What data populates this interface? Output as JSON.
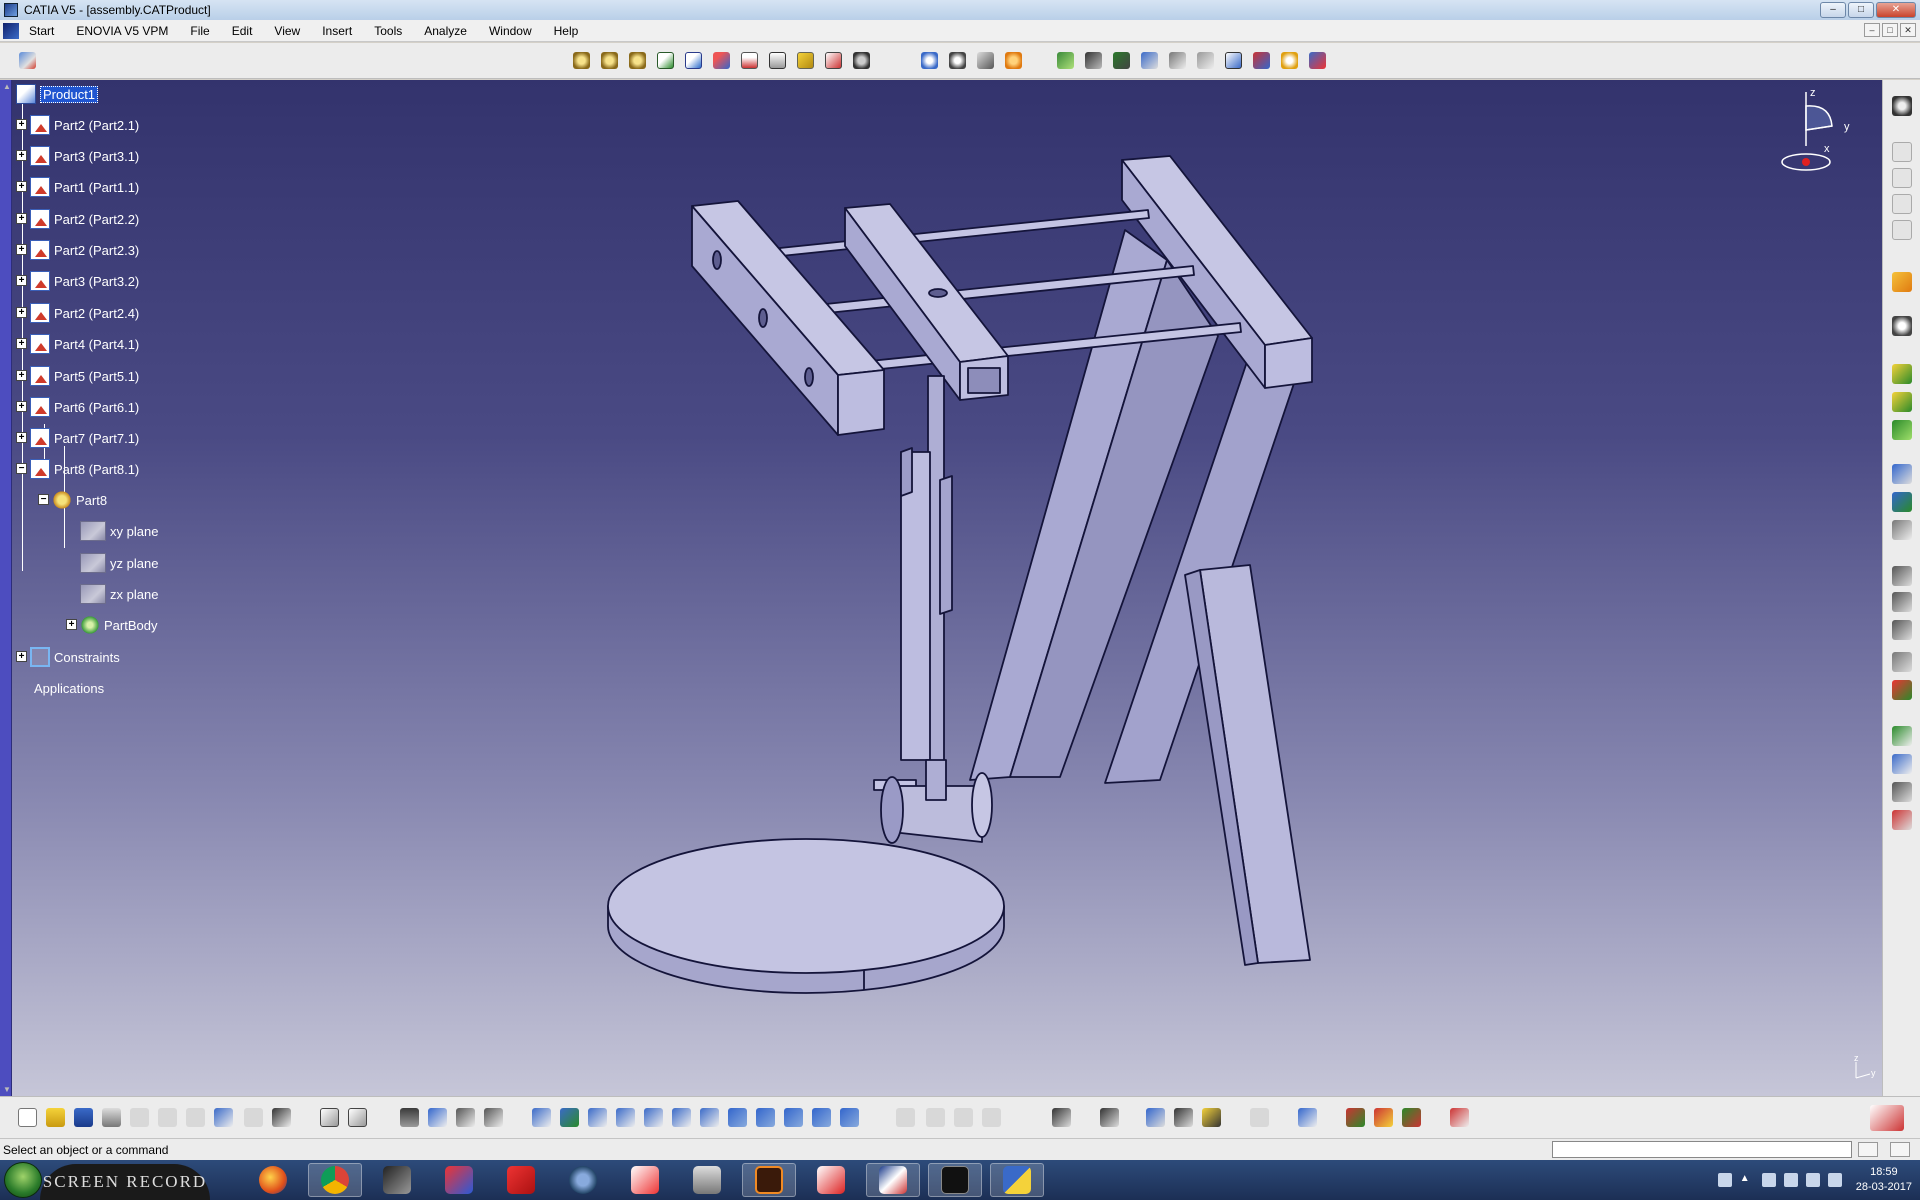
{
  "window": {
    "title": "CATIA V5 - [assembly.CATProduct]",
    "controls": {
      "minimize": "–",
      "maximize": "□",
      "close": "✕"
    }
  },
  "menu": {
    "items": [
      "Start",
      "ENOVIA V5 VPM",
      "File",
      "Edit",
      "View",
      "Insert",
      "Tools",
      "Analyze",
      "Window",
      "Help"
    ]
  },
  "tree": {
    "root": "Product1",
    "parts": [
      "Part2 (Part2.1)",
      "Part3 (Part3.1)",
      "Part1 (Part1.1)",
      "Part2 (Part2.2)",
      "Part2 (Part2.3)",
      "Part3 (Part3.2)",
      "Part2 (Part2.4)",
      "Part4 (Part4.1)",
      "Part5 (Part5.1)",
      "Part6 (Part6.1)",
      "Part7 (Part7.1)",
      "Part8 (Part8.1)"
    ],
    "part8_child": "Part8",
    "planes": [
      "xy plane",
      "yz plane",
      "zx plane"
    ],
    "body": "PartBody",
    "constraints": "Constraints",
    "applications": "Applications"
  },
  "compass": {
    "z": "z",
    "y": "y",
    "x": "x"
  },
  "mini_axis": {
    "z": "z",
    "y": "y"
  },
  "status": {
    "message": "Select an object or a command",
    "command_input": ""
  },
  "taskbar": {
    "recorder_label": "SCREEN RECORD",
    "time": "18:59",
    "date": "28-03-2017",
    "apps": [
      "firefox-icon",
      "chrome-icon",
      "zbrush-icon",
      "app-red-icon",
      "sketchup-icon",
      "app-blue-icon",
      "acrobat-icon",
      "printer-icon",
      "illustrator-icon",
      "app-red2-icon",
      "catia-icon",
      "terminal-icon",
      "python-icon"
    ]
  },
  "colors": {
    "viewport_top": "#33336d",
    "viewport_bottom": "#c6c6d8",
    "model_fill": "#b9b9dc",
    "model_edge": "#14143a",
    "selection": "#2055d0",
    "tree_text": "#ffffff"
  }
}
